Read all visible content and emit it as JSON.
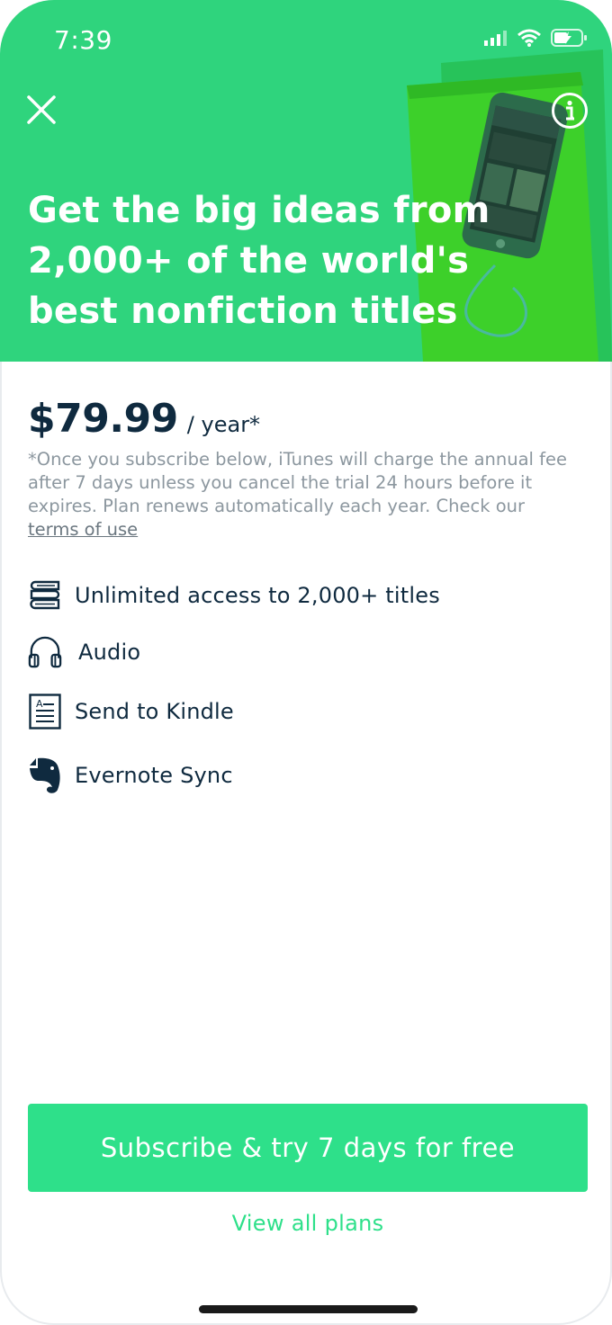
{
  "status_bar": {
    "time": "7:39"
  },
  "hero": {
    "headline_lines": [
      "Get the big ideas from",
      "2,000+ of the world's",
      "best nonfiction titles"
    ],
    "background_color": "#2fd47d",
    "close_icon": "close-icon",
    "info_icon": "info-icon"
  },
  "pricing": {
    "price": "$79.99",
    "period": "/ year*",
    "disclaimer": "*Once you subscribe below, iTunes will charge the annual fee after 7 days unless you cancel the trial 24 hours before it expires. Plan renews automatically each year. Check our",
    "terms_link": "terms of use"
  },
  "features": [
    {
      "icon": "books-icon",
      "label": "Unlimited access to 2,000+ titles"
    },
    {
      "icon": "headphones-icon",
      "label": "Audio"
    },
    {
      "icon": "document-icon",
      "label": "Send to Kindle"
    },
    {
      "icon": "evernote-icon",
      "label": "Evernote Sync"
    }
  ],
  "cta": {
    "subscribe_label": "Subscribe & try 7 days for free",
    "view_plans_label": "View all plans",
    "accent_color": "#2ee08a"
  }
}
